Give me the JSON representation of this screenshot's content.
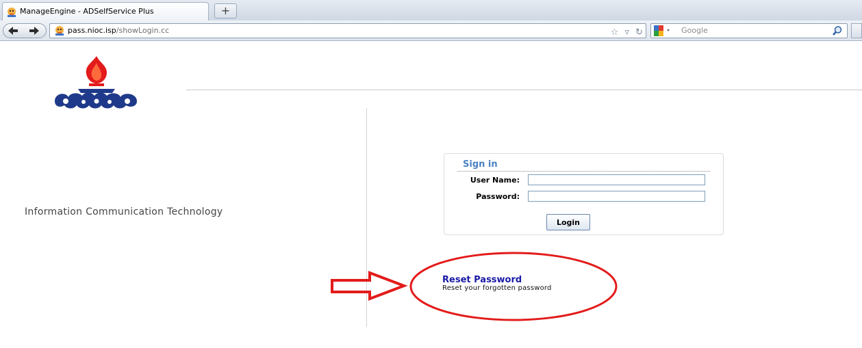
{
  "browser": {
    "tab_title": "ManageEngine - ADSelfService Plus",
    "new_tab_symbol": "+",
    "url_host": "pass.nioc.isp",
    "url_path": "/showLogin.cc",
    "search_placeholder": "Google",
    "icons": [
      "app-favicon",
      "back-arrow-icon",
      "forward-arrow-icon",
      "bookmark-star-icon",
      "dropdown-icon",
      "reload-icon",
      "google-icon",
      "magnifier-icon"
    ]
  },
  "page": {
    "org_name": "Information Communication Technology",
    "logo_icon": "flame-logo-icon"
  },
  "login": {
    "title": "Sign in",
    "username_label": "User Name:",
    "username_value": "",
    "password_label": "Password:",
    "password_value": "",
    "button_label": "Login"
  },
  "reset": {
    "link_text": "Reset Password",
    "description": "Reset your forgotten password"
  },
  "colors": {
    "signin_title": "#4a82c4",
    "reset_link": "#1a1aa6",
    "annotation_red": "#e31b1b"
  }
}
